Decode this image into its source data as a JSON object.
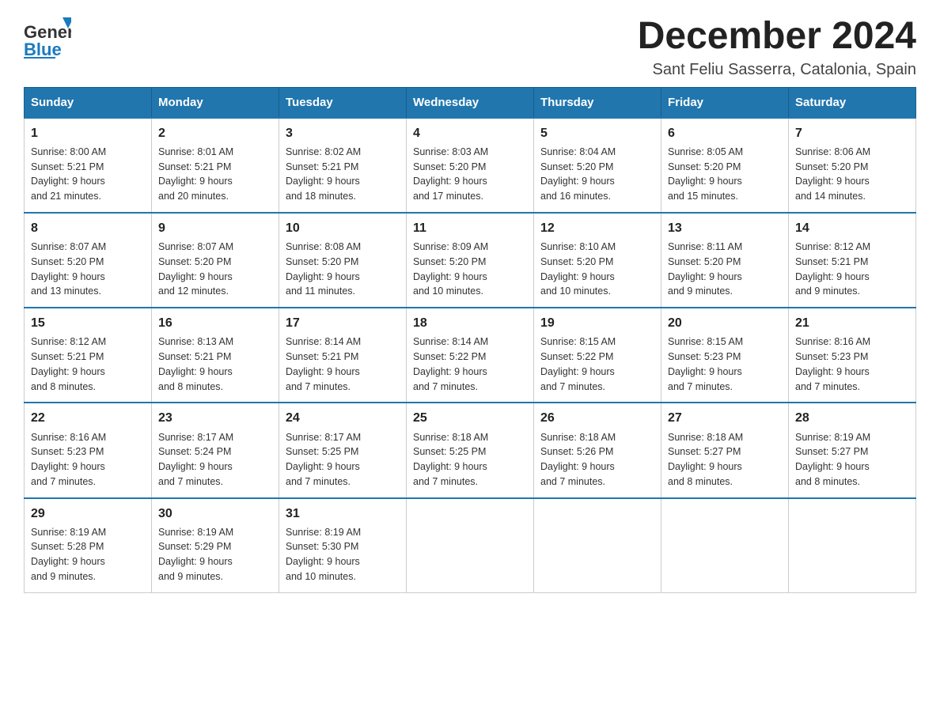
{
  "header": {
    "logo_general": "General",
    "logo_blue": "Blue",
    "month_title": "December 2024",
    "location": "Sant Feliu Sasserra, Catalonia, Spain"
  },
  "weekdays": [
    "Sunday",
    "Monday",
    "Tuesday",
    "Wednesday",
    "Thursday",
    "Friday",
    "Saturday"
  ],
  "weeks": [
    [
      {
        "day": "1",
        "sunrise": "8:00 AM",
        "sunset": "5:21 PM",
        "daylight": "9 hours and 21 minutes."
      },
      {
        "day": "2",
        "sunrise": "8:01 AM",
        "sunset": "5:21 PM",
        "daylight": "9 hours and 20 minutes."
      },
      {
        "day": "3",
        "sunrise": "8:02 AM",
        "sunset": "5:21 PM",
        "daylight": "9 hours and 18 minutes."
      },
      {
        "day": "4",
        "sunrise": "8:03 AM",
        "sunset": "5:20 PM",
        "daylight": "9 hours and 17 minutes."
      },
      {
        "day": "5",
        "sunrise": "8:04 AM",
        "sunset": "5:20 PM",
        "daylight": "9 hours and 16 minutes."
      },
      {
        "day": "6",
        "sunrise": "8:05 AM",
        "sunset": "5:20 PM",
        "daylight": "9 hours and 15 minutes."
      },
      {
        "day": "7",
        "sunrise": "8:06 AM",
        "sunset": "5:20 PM",
        "daylight": "9 hours and 14 minutes."
      }
    ],
    [
      {
        "day": "8",
        "sunrise": "8:07 AM",
        "sunset": "5:20 PM",
        "daylight": "9 hours and 13 minutes."
      },
      {
        "day": "9",
        "sunrise": "8:07 AM",
        "sunset": "5:20 PM",
        "daylight": "9 hours and 12 minutes."
      },
      {
        "day": "10",
        "sunrise": "8:08 AM",
        "sunset": "5:20 PM",
        "daylight": "9 hours and 11 minutes."
      },
      {
        "day": "11",
        "sunrise": "8:09 AM",
        "sunset": "5:20 PM",
        "daylight": "9 hours and 10 minutes."
      },
      {
        "day": "12",
        "sunrise": "8:10 AM",
        "sunset": "5:20 PM",
        "daylight": "9 hours and 10 minutes."
      },
      {
        "day": "13",
        "sunrise": "8:11 AM",
        "sunset": "5:20 PM",
        "daylight": "9 hours and 9 minutes."
      },
      {
        "day": "14",
        "sunrise": "8:12 AM",
        "sunset": "5:21 PM",
        "daylight": "9 hours and 9 minutes."
      }
    ],
    [
      {
        "day": "15",
        "sunrise": "8:12 AM",
        "sunset": "5:21 PM",
        "daylight": "9 hours and 8 minutes."
      },
      {
        "day": "16",
        "sunrise": "8:13 AM",
        "sunset": "5:21 PM",
        "daylight": "9 hours and 8 minutes."
      },
      {
        "day": "17",
        "sunrise": "8:14 AM",
        "sunset": "5:21 PM",
        "daylight": "9 hours and 7 minutes."
      },
      {
        "day": "18",
        "sunrise": "8:14 AM",
        "sunset": "5:22 PM",
        "daylight": "9 hours and 7 minutes."
      },
      {
        "day": "19",
        "sunrise": "8:15 AM",
        "sunset": "5:22 PM",
        "daylight": "9 hours and 7 minutes."
      },
      {
        "day": "20",
        "sunrise": "8:15 AM",
        "sunset": "5:23 PM",
        "daylight": "9 hours and 7 minutes."
      },
      {
        "day": "21",
        "sunrise": "8:16 AM",
        "sunset": "5:23 PM",
        "daylight": "9 hours and 7 minutes."
      }
    ],
    [
      {
        "day": "22",
        "sunrise": "8:16 AM",
        "sunset": "5:23 PM",
        "daylight": "9 hours and 7 minutes."
      },
      {
        "day": "23",
        "sunrise": "8:17 AM",
        "sunset": "5:24 PM",
        "daylight": "9 hours and 7 minutes."
      },
      {
        "day": "24",
        "sunrise": "8:17 AM",
        "sunset": "5:25 PM",
        "daylight": "9 hours and 7 minutes."
      },
      {
        "day": "25",
        "sunrise": "8:18 AM",
        "sunset": "5:25 PM",
        "daylight": "9 hours and 7 minutes."
      },
      {
        "day": "26",
        "sunrise": "8:18 AM",
        "sunset": "5:26 PM",
        "daylight": "9 hours and 7 minutes."
      },
      {
        "day": "27",
        "sunrise": "8:18 AM",
        "sunset": "5:27 PM",
        "daylight": "9 hours and 8 minutes."
      },
      {
        "day": "28",
        "sunrise": "8:19 AM",
        "sunset": "5:27 PM",
        "daylight": "9 hours and 8 minutes."
      }
    ],
    [
      {
        "day": "29",
        "sunrise": "8:19 AM",
        "sunset": "5:28 PM",
        "daylight": "9 hours and 9 minutes."
      },
      {
        "day": "30",
        "sunrise": "8:19 AM",
        "sunset": "5:29 PM",
        "daylight": "9 hours and 9 minutes."
      },
      {
        "day": "31",
        "sunrise": "8:19 AM",
        "sunset": "5:30 PM",
        "daylight": "9 hours and 10 minutes."
      },
      null,
      null,
      null,
      null
    ]
  ],
  "labels": {
    "sunrise": "Sunrise:",
    "sunset": "Sunset:",
    "daylight": "Daylight:"
  }
}
